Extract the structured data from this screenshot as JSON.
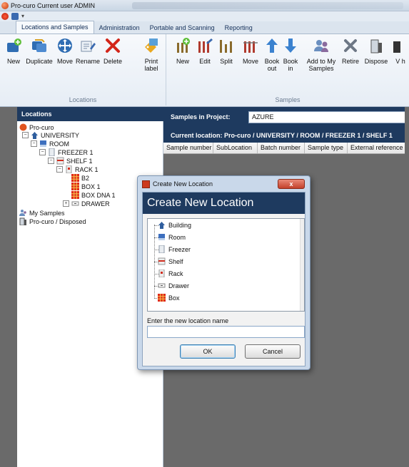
{
  "window": {
    "title": "Pro-curo  Current user ADMIN"
  },
  "ribbon_tabs": [
    {
      "label": "Locations and Samples",
      "active": true
    },
    {
      "label": "Administration",
      "active": false
    },
    {
      "label": "Portable and Scanning",
      "active": false
    },
    {
      "label": "Reporting",
      "active": false
    }
  ],
  "ribbon": {
    "locations_group": {
      "label": "Locations",
      "buttons": [
        {
          "label": "New",
          "icon": "new-location-icon"
        },
        {
          "label": "Duplicate",
          "icon": "duplicate-icon"
        },
        {
          "label": "Move",
          "icon": "move-icon"
        },
        {
          "label": "Rename",
          "icon": "rename-icon"
        },
        {
          "label": "Delete",
          "icon": "delete-icon"
        },
        {
          "label": "Print label",
          "icon": "print-label-icon"
        }
      ]
    },
    "samples_group": {
      "label": "Samples",
      "buttons": [
        {
          "label": "New",
          "icon": "new-sample-icon"
        },
        {
          "label": "Edit",
          "icon": "edit-sample-icon"
        },
        {
          "label": "Split",
          "icon": "split-icon"
        },
        {
          "label": "Move",
          "icon": "move-sample-icon"
        },
        {
          "label": "Book out",
          "icon": "book-out-icon"
        },
        {
          "label": "Book in",
          "icon": "book-in-icon"
        },
        {
          "label": "Add to My Samples",
          "icon": "add-to-my-samples-icon"
        },
        {
          "label": "Retire",
          "icon": "retire-icon"
        },
        {
          "label": "Dispose",
          "icon": "dispose-icon"
        },
        {
          "label": "V h",
          "icon": "more-icon"
        }
      ]
    }
  },
  "locations_panel": {
    "header": "Locations",
    "tree": [
      {
        "label": "Pro-curo",
        "icon": "procuro-icon",
        "level": 0,
        "expander": ""
      },
      {
        "label": "UNIVERSITY",
        "icon": "building-icon",
        "level": 1,
        "expander": "−"
      },
      {
        "label": "ROOM",
        "icon": "room-icon",
        "level": 2,
        "expander": "−"
      },
      {
        "label": "FREEZER 1",
        "icon": "freezer-icon",
        "level": 3,
        "expander": "−"
      },
      {
        "label": "SHELF 1",
        "icon": "shelf-icon",
        "level": 4,
        "expander": "−"
      },
      {
        "label": "RACK 1",
        "icon": "rack-icon",
        "level": 5,
        "expander": "−"
      },
      {
        "label": "B2",
        "icon": "box-icon",
        "level": 6,
        "expander": ""
      },
      {
        "label": "BOX 1",
        "icon": "box-icon",
        "level": 6,
        "expander": ""
      },
      {
        "label": "BOX DNA 1",
        "icon": "box-icon",
        "level": 6,
        "expander": ""
      },
      {
        "label": "DRAWER",
        "icon": "drawer-icon",
        "level": 5,
        "expander": "+"
      },
      {
        "label": "My Samples",
        "icon": "my-samples-icon",
        "level": 0,
        "expander": ""
      },
      {
        "label": "Pro-curo / Disposed",
        "icon": "disposed-icon",
        "level": 0,
        "expander": ""
      }
    ]
  },
  "samples_panel": {
    "project_label": "Samples in Project:",
    "project_value": "AZURE",
    "current_location": "Current location: Pro-curo / UNIVERSITY / ROOM / FREEZER 1 / SHELF 1",
    "columns": [
      "Sample number",
      "SubLocation",
      "Batch number",
      "Sample type",
      "External reference"
    ]
  },
  "dialog": {
    "window_title": "Create New Location",
    "close_label": "x",
    "banner": "Create New Location",
    "types": [
      {
        "label": "Building",
        "icon": "building-icon"
      },
      {
        "label": "Room",
        "icon": "room-icon"
      },
      {
        "label": "Freezer",
        "icon": "freezer-icon"
      },
      {
        "label": "Shelf",
        "icon": "shelf-icon"
      },
      {
        "label": "Rack",
        "icon": "rack-icon"
      },
      {
        "label": "Drawer",
        "icon": "drawer-icon"
      },
      {
        "label": "Box",
        "icon": "box-icon"
      }
    ],
    "name_label": "Enter the new location name",
    "name_value": "",
    "ok_label": "OK",
    "cancel_label": "Cancel"
  }
}
